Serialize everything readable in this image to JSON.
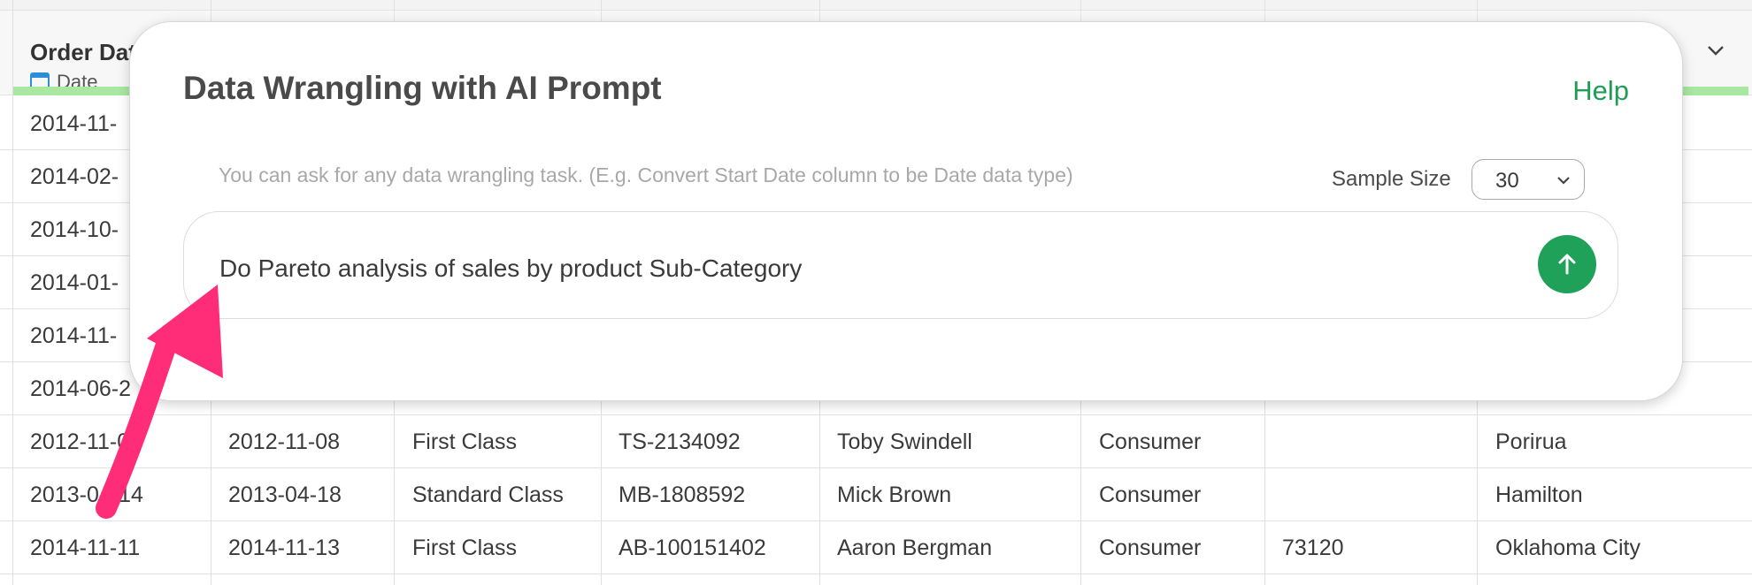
{
  "grid": {
    "first_column": {
      "name": "Order Dat",
      "type_label": "Date"
    },
    "hidden_rows_first_col": [
      "2014-11-",
      "2014-02-",
      "2014-10-",
      "2014-01-",
      "2014-11-",
      "2014-06-2"
    ],
    "rows": [
      [
        "2012-11-06",
        "2012-11-08",
        "First Class",
        "TS-2134092",
        "Toby Swindell",
        "Consumer",
        "",
        "Porirua"
      ],
      [
        "2013-04-14",
        "2013-04-18",
        "Standard Class",
        "MB-1808592",
        "Mick Brown",
        "Consumer",
        "",
        "Hamilton"
      ],
      [
        "2014-11-11",
        "2014-11-13",
        "First Class",
        "AB-100151402",
        "Aaron Bergman",
        "Consumer",
        "73120",
        "Oklahoma City"
      ]
    ]
  },
  "modal": {
    "title": "Data Wrangling with AI Prompt",
    "help_label": "Help",
    "hint": "You can ask for any data wrangling task. (E.g. Convert Start Date column to be Date data type)",
    "sample_size_label": "Sample Size",
    "sample_size_value": "30",
    "prompt_text": "Do Pareto analysis of sales by product Sub-Category",
    "send_icon": "arrow-up-icon"
  },
  "colors": {
    "accent_green": "#1fa15a",
    "quality_bar": "#a9e8a1",
    "annotation_arrow": "#ff2d78"
  }
}
